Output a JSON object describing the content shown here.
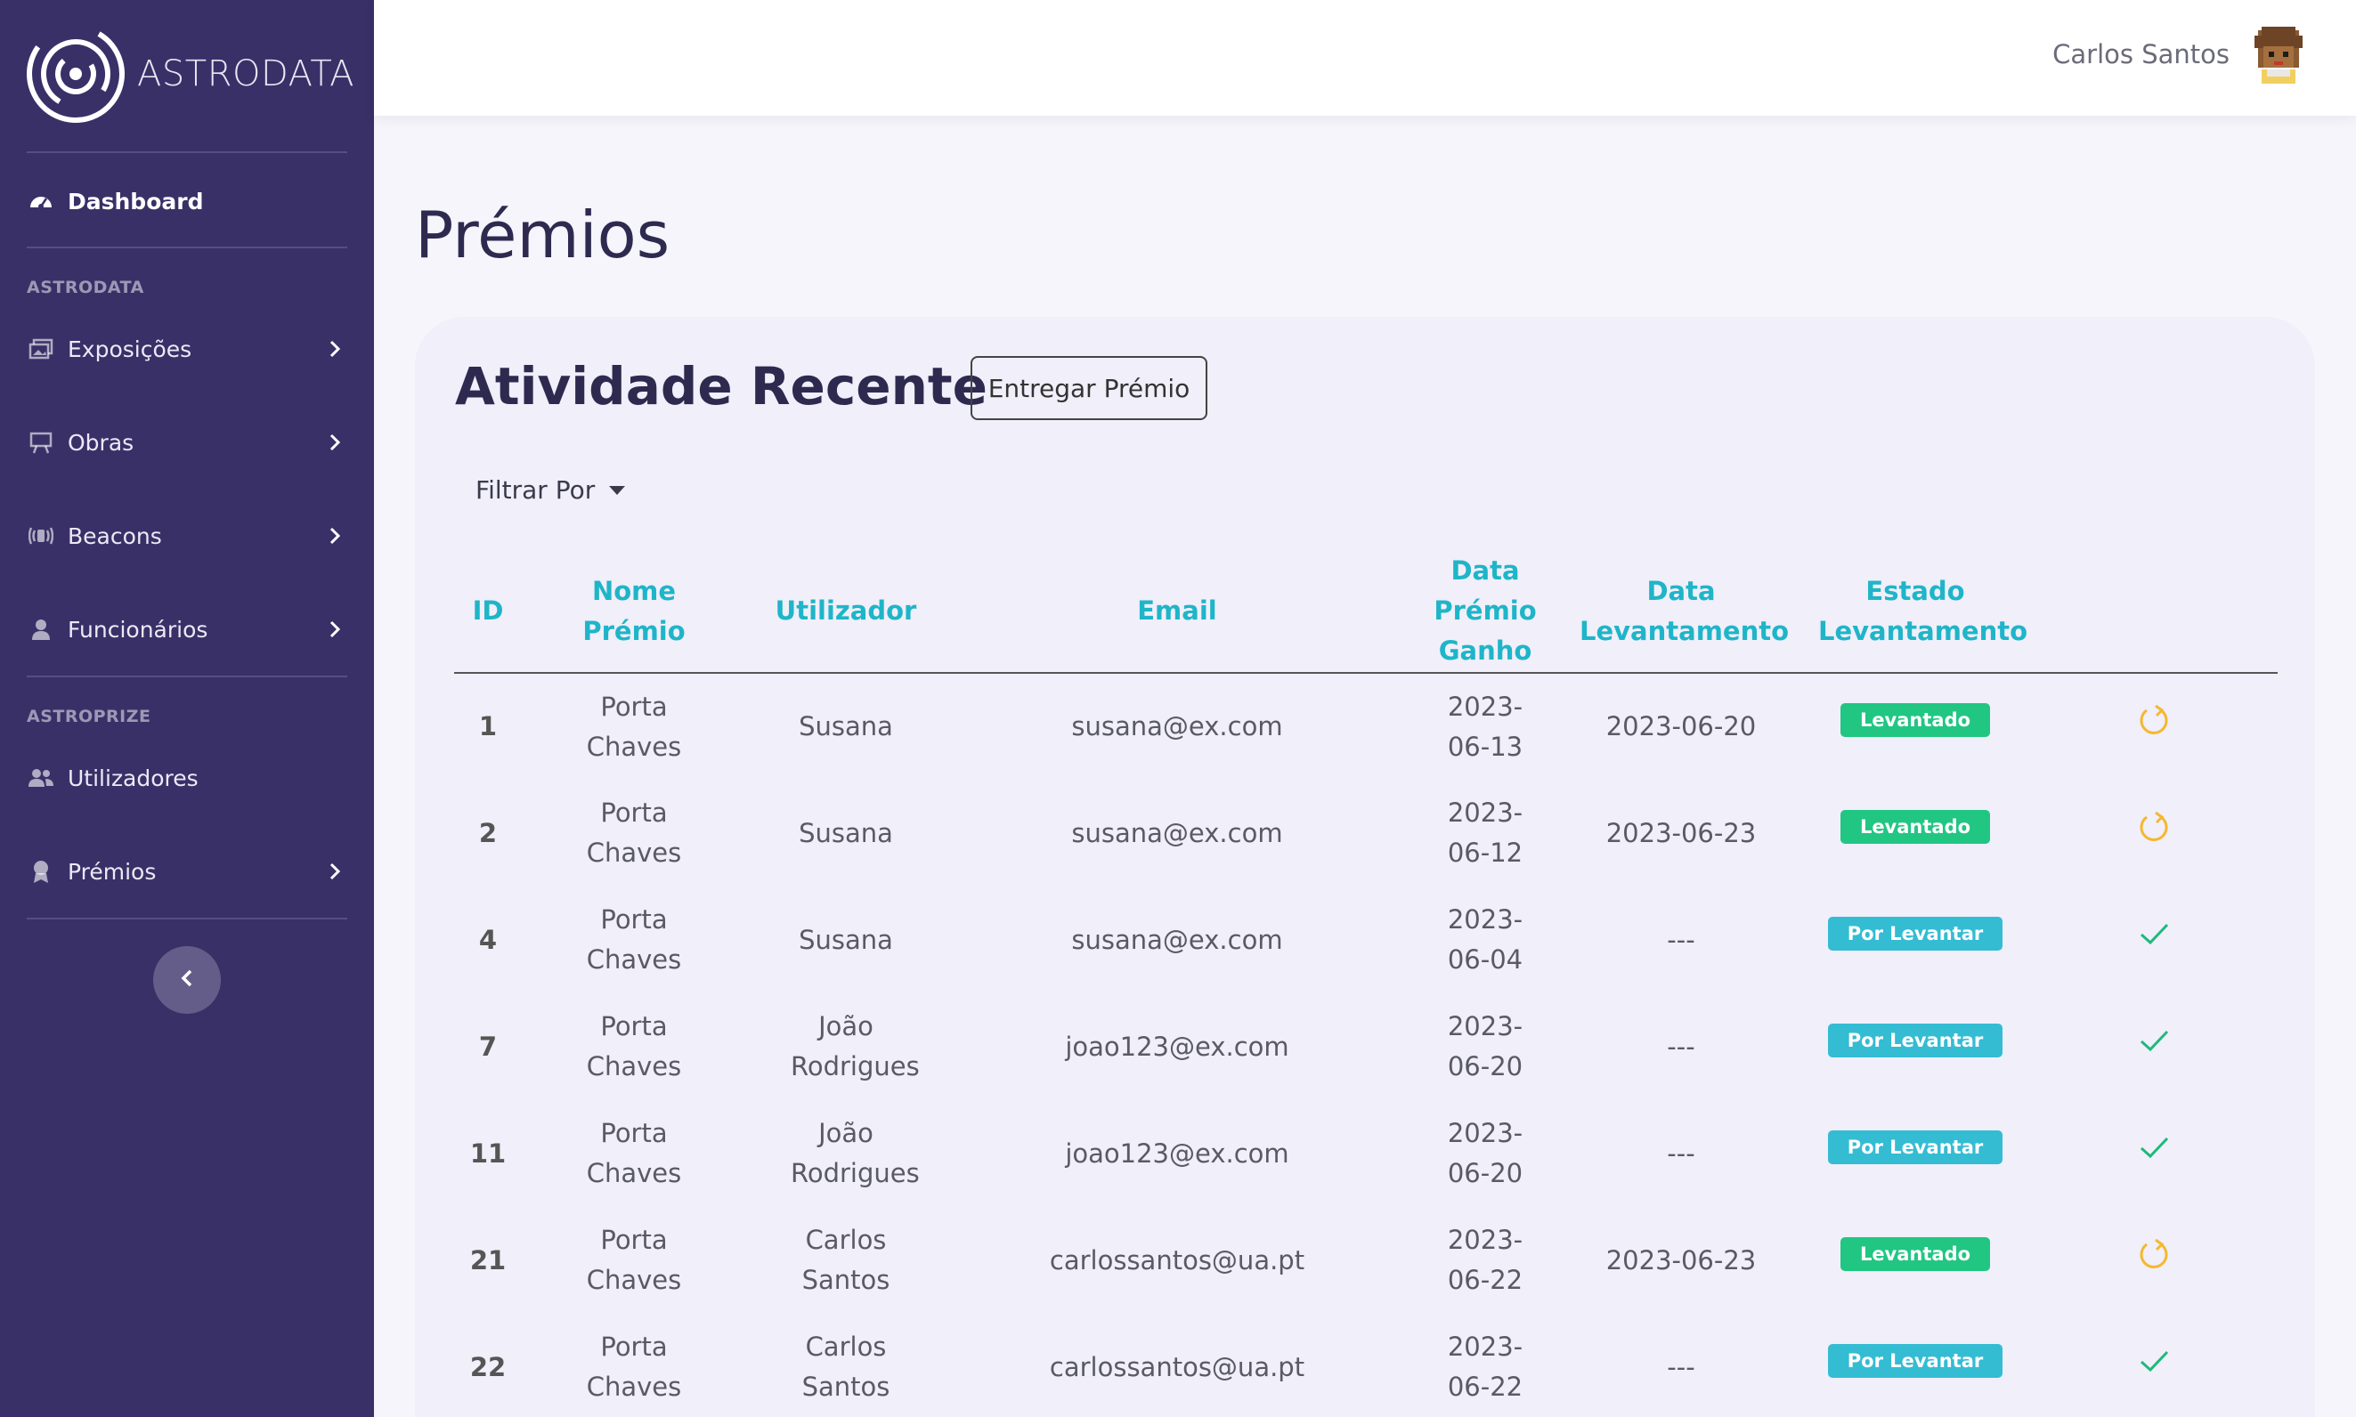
{
  "app": {
    "brand": "ASTRODATA"
  },
  "user": {
    "name": "Carlos Santos"
  },
  "sidebar": {
    "dashboard": "Dashboard",
    "section1": "ASTRODATA",
    "items1": [
      {
        "label": "Exposições",
        "icon": "images-icon"
      },
      {
        "label": "Obras",
        "icon": "easel-icon"
      },
      {
        "label": "Beacons",
        "icon": "broadcast-icon"
      },
      {
        "label": "Funcionários",
        "icon": "person-icon"
      }
    ],
    "section2": "ASTROPRIZE",
    "items2": [
      {
        "label": "Utilizadores",
        "icon": "users-icon"
      },
      {
        "label": "Prémios",
        "icon": "award-icon"
      }
    ]
  },
  "page": {
    "title": "Prémios"
  },
  "card": {
    "title": "Atividade Recente",
    "deliver_button": "Entregar Prémio",
    "filter_label": "Filtrar Por"
  },
  "table": {
    "headers": {
      "id": "ID",
      "prize_name": "Nome Prémio",
      "user": "Utilizador",
      "email": "Email",
      "date_won": "Data Prémio Ganho",
      "date_collected": "Data Levantamento",
      "status": "Estado Levantamento"
    },
    "rows": [
      {
        "id": "1",
        "prize": "Porta Chaves",
        "user": "Susana",
        "email": "susana@ex.com",
        "date_won": "2023-06-13",
        "date_collected": "2023-06-20",
        "status": "Levantado",
        "action": "undo"
      },
      {
        "id": "2",
        "prize": "Porta Chaves",
        "user": "Susana",
        "email": "susana@ex.com",
        "date_won": "2023-06-12",
        "date_collected": "2023-06-23",
        "status": "Levantado",
        "action": "undo"
      },
      {
        "id": "4",
        "prize": "Porta Chaves",
        "user": "Susana",
        "email": "susana@ex.com",
        "date_won": "2023-06-04",
        "date_collected": "---",
        "status": "Por Levantar",
        "action": "check"
      },
      {
        "id": "7",
        "prize": "Porta Chaves",
        "user": "João Rodrigues",
        "email": "joao123@ex.com",
        "date_won": "2023-06-20",
        "date_collected": "---",
        "status": "Por Levantar",
        "action": "check"
      },
      {
        "id": "11",
        "prize": "Porta Chaves",
        "user": "João Rodrigues",
        "email": "joao123@ex.com",
        "date_won": "2023-06-20",
        "date_collected": "---",
        "status": "Por Levantar",
        "action": "check"
      },
      {
        "id": "21",
        "prize": "Porta Chaves",
        "user": "Carlos Santos",
        "email": "carlossantos@ua.pt",
        "date_won": "2023-06-22",
        "date_collected": "2023-06-23",
        "status": "Levantado",
        "action": "undo"
      },
      {
        "id": "22",
        "prize": "Porta Chaves",
        "user": "Carlos Santos",
        "email": "carlossantos@ua.pt",
        "date_won": "2023-06-22",
        "date_collected": "---",
        "status": "Por Levantar",
        "action": "check"
      }
    ]
  },
  "colors": {
    "sidebar": "#3a3068",
    "accent": "#1fb5c8",
    "collected": "#21c683",
    "pending": "#34bcd3",
    "undo": "#f5b82e",
    "check": "#1dba7a"
  }
}
